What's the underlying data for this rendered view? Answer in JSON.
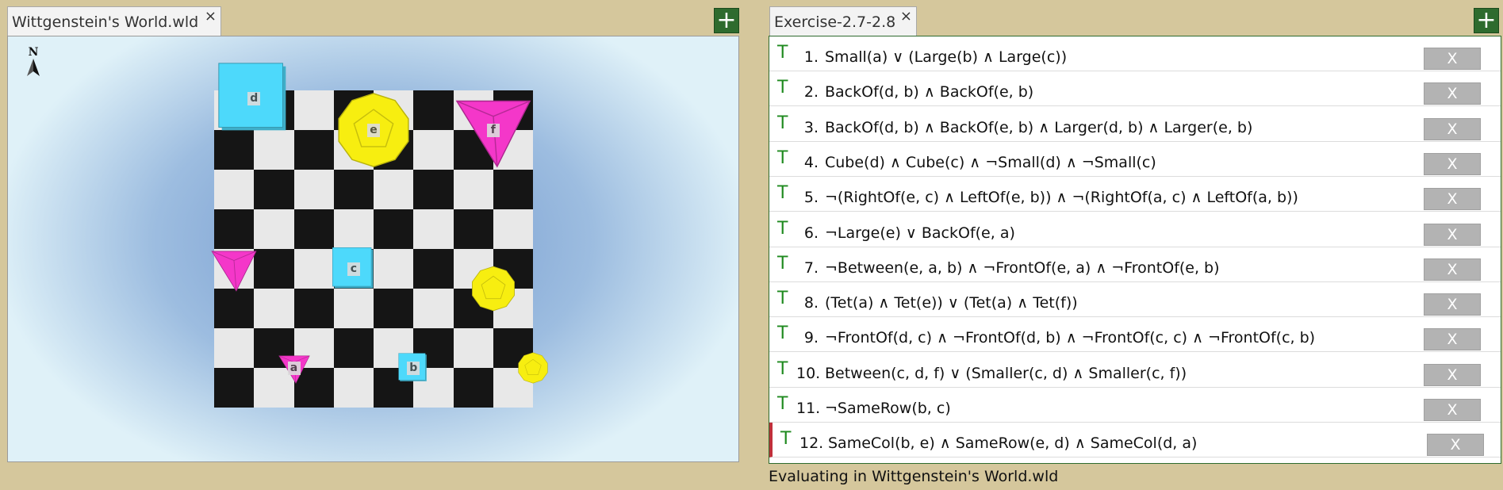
{
  "left_tab": {
    "title": "Wittgenstein's World.wld",
    "close": "×"
  },
  "right_tab": {
    "title": "Exercise-2.7-2.8",
    "close": "×"
  },
  "add_symbol": "+",
  "compass": {
    "label": "N"
  },
  "objects": [
    {
      "name": "d",
      "shape": "cube",
      "size": "large",
      "color": "#4dd9fb",
      "col": 0.5,
      "row": -0.3
    },
    {
      "name": "e",
      "shape": "dodec",
      "size": "large",
      "color": "#f7ee10",
      "col": 3.5,
      "row": 0.5
    },
    {
      "name": "f",
      "shape": "tet",
      "size": "large",
      "color": "#f437c9",
      "col": 6.5,
      "row": 0.5
    },
    {
      "name": "",
      "shape": "tet",
      "size": "medium",
      "color": "#f437c9",
      "col": 0,
      "row": 4
    },
    {
      "name": "c",
      "shape": "cube",
      "size": "medium",
      "color": "#4dd9fb",
      "col": 3,
      "row": 4
    },
    {
      "name": "",
      "shape": "dodec",
      "size": "medium",
      "color": "#f7ee10",
      "col": 6.5,
      "row": 4.5
    },
    {
      "name": "a",
      "shape": "tet",
      "size": "small",
      "color": "#f437c9",
      "col": 1.5,
      "row": 6.5
    },
    {
      "name": "b",
      "shape": "cube",
      "size": "small",
      "color": "#4dd9fb",
      "col": 4.5,
      "row": 6.5
    },
    {
      "name": "",
      "shape": "dodec",
      "size": "small",
      "color": "#f7ee10",
      "col": 7.5,
      "row": 6.5
    }
  ],
  "sentences": [
    {
      "value": "T",
      "num": "1.",
      "text": "Small(a) ∨ (Large(b) ∧ Large(c))"
    },
    {
      "value": "T",
      "num": "2.",
      "text": "BackOf(d, b) ∧ BackOf(e, b)"
    },
    {
      "value": "T",
      "num": "3.",
      "text": "BackOf(d, b) ∧ BackOf(e, b) ∧ Larger(d, b) ∧ Larger(e, b)"
    },
    {
      "value": "T",
      "num": "4.",
      "text": "Cube(d) ∧ Cube(c) ∧ ¬Small(d) ∧ ¬Small(c)"
    },
    {
      "value": "T",
      "num": "5.",
      "text": "¬(RightOf(e, c) ∧ LeftOf(e, b)) ∧ ¬(RightOf(a, c) ∧ LeftOf(a, b))"
    },
    {
      "value": "T",
      "num": "6.",
      "text": "¬Large(e) ∨ BackOf(e, a)"
    },
    {
      "value": "T",
      "num": "7.",
      "text": "¬Between(e, a, b) ∧ ¬FrontOf(e, a) ∧ ¬FrontOf(e, b)"
    },
    {
      "value": "T",
      "num": "8.",
      "text": "(Tet(a) ∧ Tet(e)) ∨ (Tet(a) ∧ Tet(f))"
    },
    {
      "value": "T",
      "num": "9.",
      "text": "¬FrontOf(d, c) ∧ ¬FrontOf(d, b) ∧ ¬FrontOf(c, c) ∧ ¬FrontOf(c, b)"
    },
    {
      "value": "T",
      "num": "10.",
      "text": "Between(c, d, f) ∨ (Smaller(c, d) ∧ Smaller(c, f))"
    },
    {
      "value": "T",
      "num": "11.",
      "text": "¬SameRow(b, c)"
    },
    {
      "value": "T",
      "num": "12.",
      "text": "SameCol(b, e) ∧ SameRow(e, d) ∧ SameCol(d, a)"
    }
  ],
  "delete_label": "X",
  "status": "Evaluating in Wittgenstein's World.wld"
}
